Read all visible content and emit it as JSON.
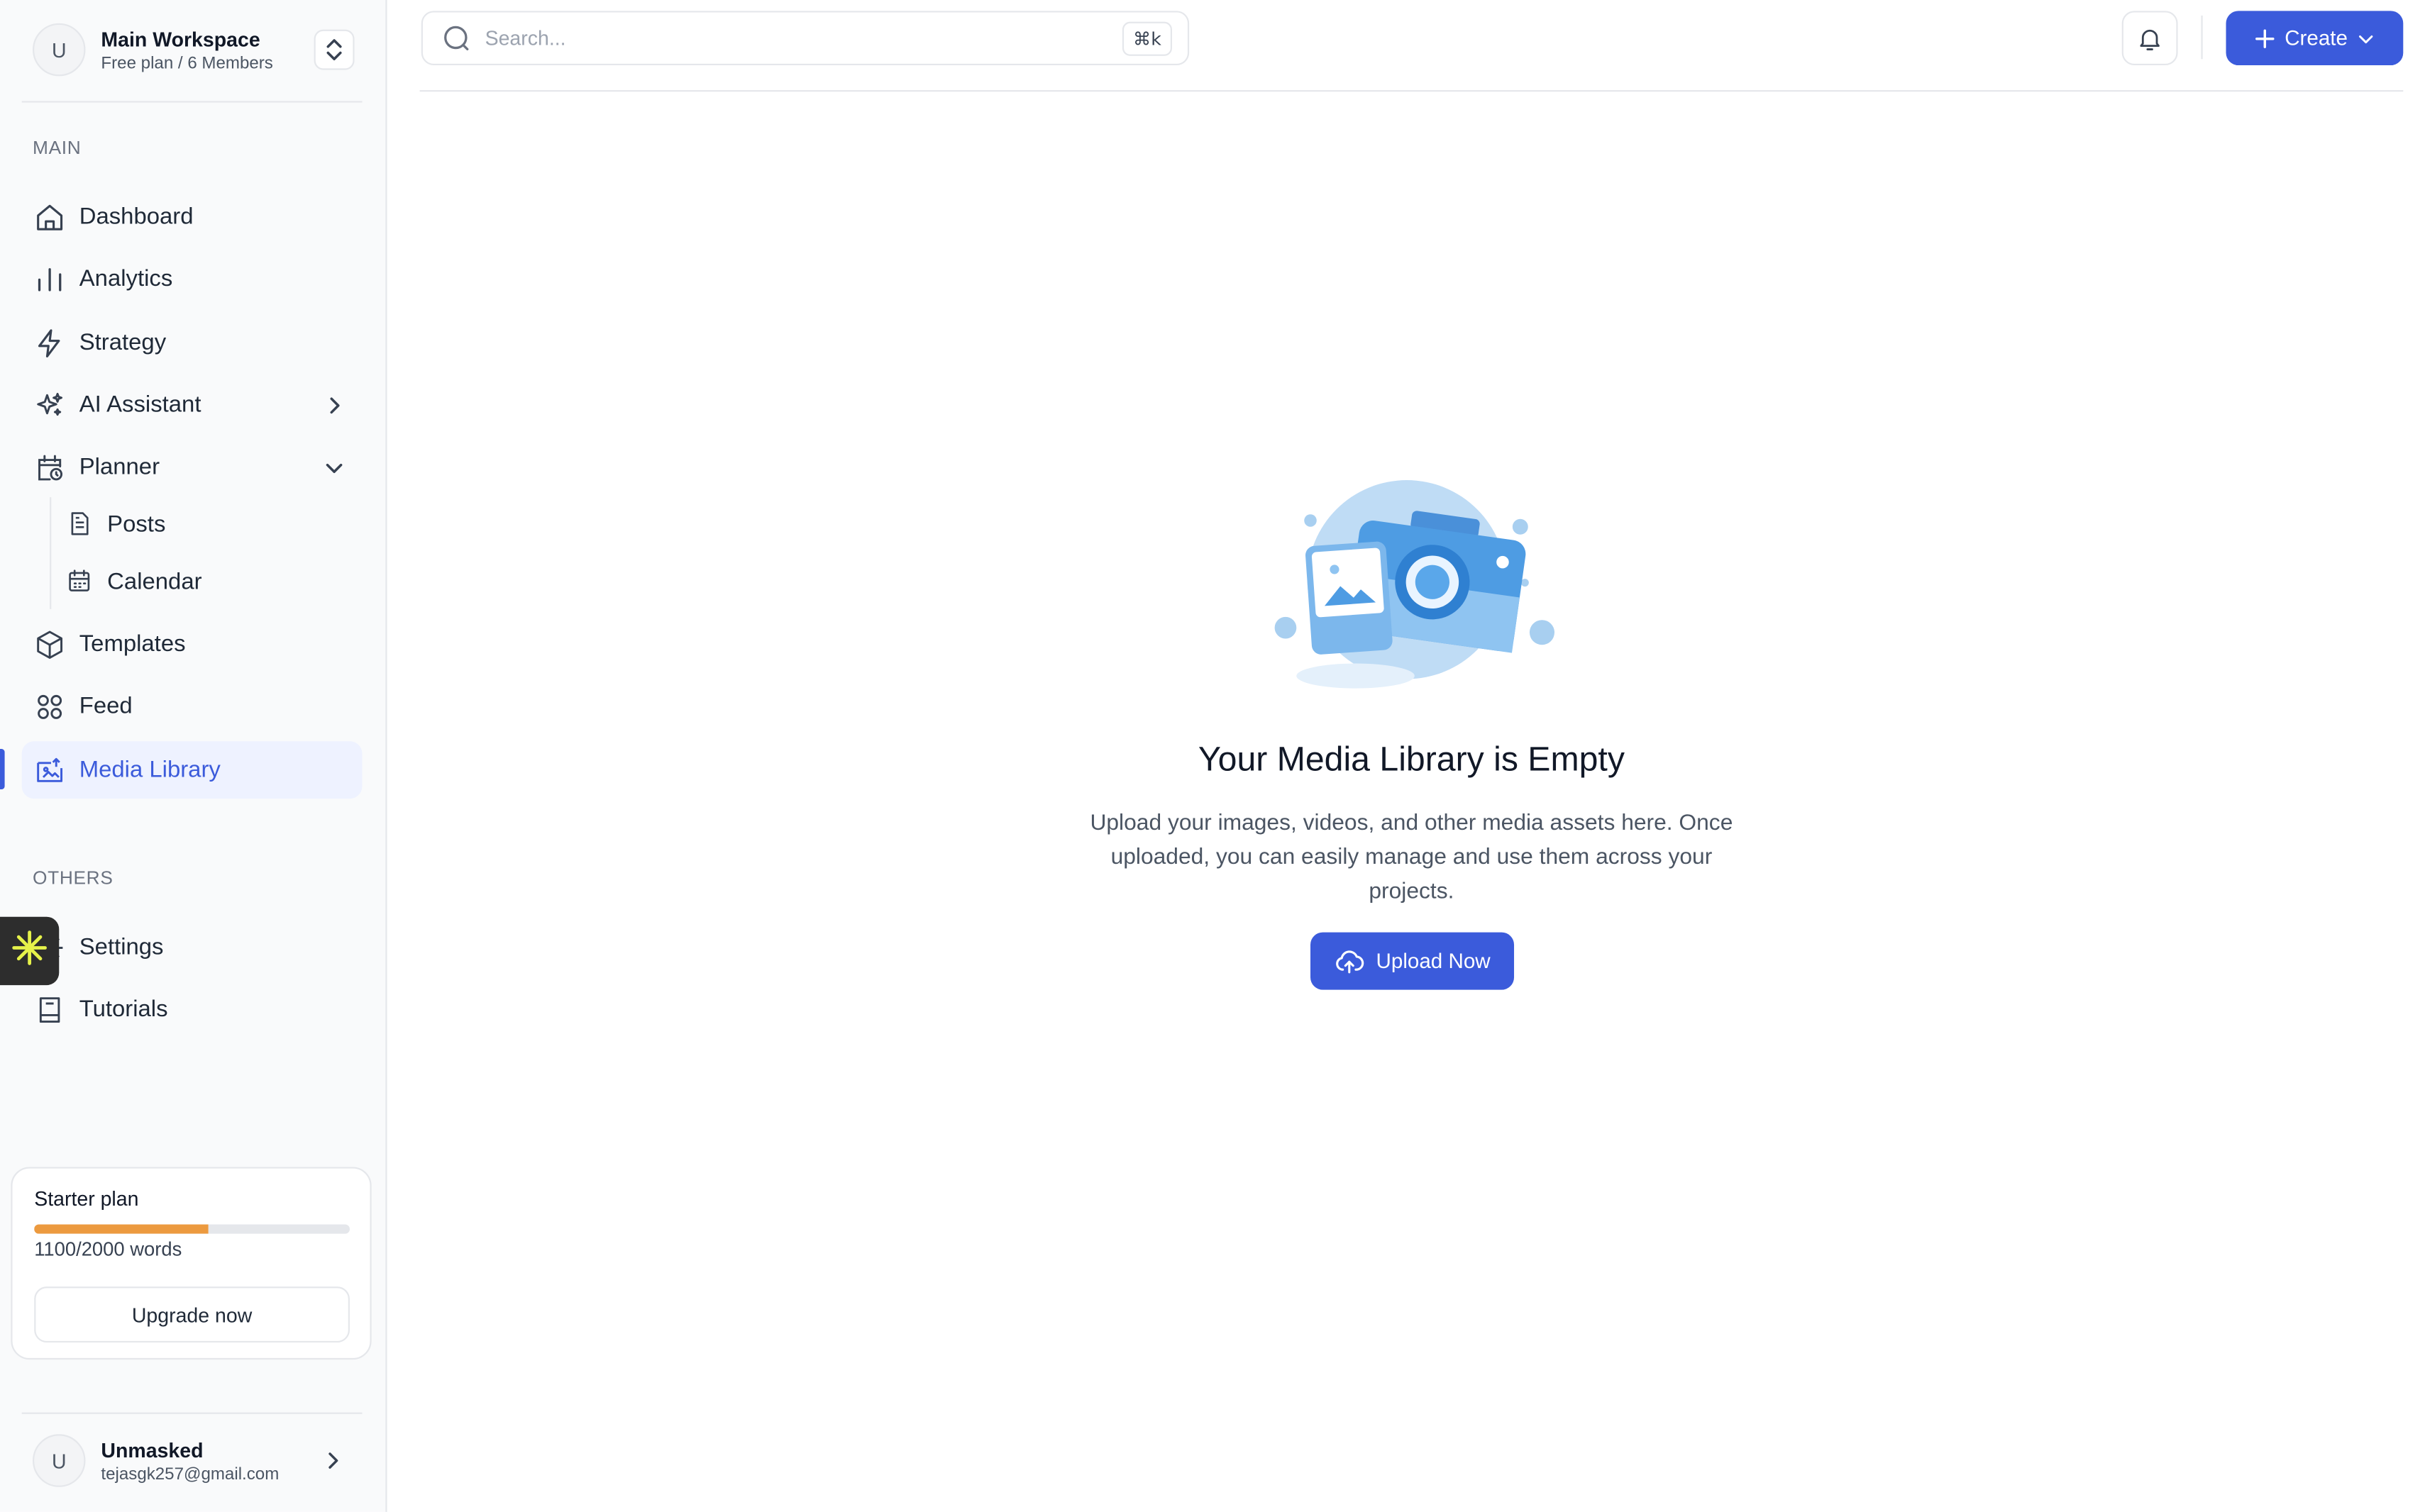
{
  "workspace": {
    "avatar_initial": "U",
    "name": "Main Workspace",
    "subtitle": "Free plan / 6 Members"
  },
  "sidebar": {
    "main_label": "MAIN",
    "items": [
      {
        "label": "Dashboard",
        "icon": "home-icon"
      },
      {
        "label": "Analytics",
        "icon": "bar-chart-icon"
      },
      {
        "label": "Strategy",
        "icon": "lightning-icon"
      },
      {
        "label": "AI Assistant",
        "icon": "sparkles-icon",
        "chevron": "right"
      },
      {
        "label": "Planner",
        "icon": "calendar-clock-icon",
        "chevron": "down",
        "expanded": true
      },
      {
        "label": "Templates",
        "icon": "cube-icon"
      },
      {
        "label": "Feed",
        "icon": "grid-circles-icon"
      },
      {
        "label": "Media Library",
        "icon": "image-icon",
        "active": true
      }
    ],
    "planner_children": [
      {
        "label": "Posts",
        "icon": "document-icon"
      },
      {
        "label": "Calendar",
        "icon": "calendar-icon"
      }
    ],
    "others_label": "OTHERS",
    "others_items": [
      {
        "label": "Settings",
        "icon": "gear-icon"
      },
      {
        "label": "Tutorials",
        "icon": "book-icon"
      }
    ]
  },
  "plan": {
    "title": "Starter plan",
    "usage_text": "1100/2000 words",
    "used": 1100,
    "total": 2000,
    "bar_color": "#ec9a3f",
    "upgrade_label": "Upgrade now"
  },
  "user": {
    "avatar_initial": "U",
    "name": "Unmasked",
    "email": "tejasgk257@gmail.com"
  },
  "topbar": {
    "search_placeholder": "Search...",
    "shortcut": "⌘k",
    "create_label": "Create"
  },
  "empty_state": {
    "title": "Your Media Library is Empty",
    "description": "Upload your images, videos, and other media assets here. Once uploaded, you can easily manage and use them across your projects.",
    "button_label": "Upload Now"
  },
  "colors": {
    "accent": "#3b5bdb",
    "active_bg": "#eef2ff",
    "sidebar_bg": "#f9fafb"
  }
}
